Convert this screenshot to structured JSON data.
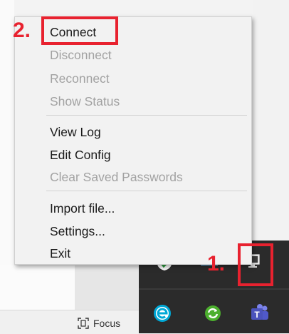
{
  "menu": {
    "items": [
      {
        "label": "Connect",
        "enabled": true
      },
      {
        "label": "Disconnect",
        "enabled": false
      },
      {
        "label": "Reconnect",
        "enabled": false
      },
      {
        "label": "Show Status",
        "enabled": false
      },
      {
        "label": "View Log",
        "enabled": true
      },
      {
        "label": "Edit Config",
        "enabled": true
      },
      {
        "label": "Clear Saved Passwords",
        "enabled": false
      },
      {
        "label": "Import file...",
        "enabled": true
      },
      {
        "label": "Settings...",
        "enabled": true
      },
      {
        "label": "Exit",
        "enabled": true
      }
    ]
  },
  "annotations": {
    "step1": "1.",
    "step2": "2."
  },
  "statusbar": {
    "focus_label": "Focus"
  },
  "tray": {
    "icons": [
      "security-shield-icon",
      "openvpn-gui-icon",
      "eset-icon",
      "sync-icon",
      "teams-icon"
    ]
  },
  "colors": {
    "annotation_red": "#e8222f",
    "tray_background": "#2b2b2b",
    "disabled_text": "#a2a2a2"
  }
}
